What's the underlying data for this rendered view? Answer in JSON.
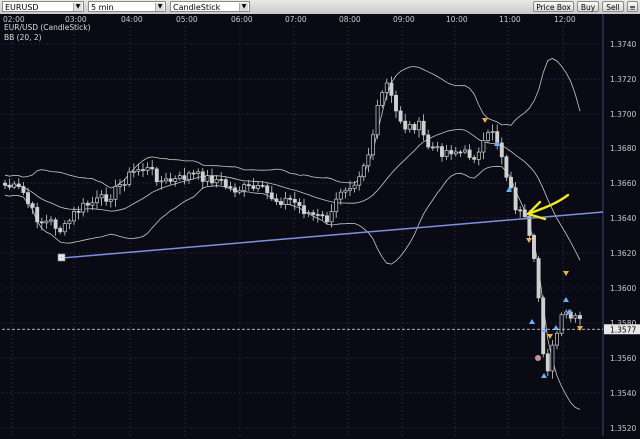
{
  "toolbar": {
    "symbol": "EURUSD",
    "timeframe": "5 min",
    "chart_type": "CandleStick",
    "price_box_label": "Price Box",
    "buy_label": "Buy",
    "sell_label": "Sell",
    "menu_label": "≡"
  },
  "chart": {
    "title": "EUR/USD (CandleStick)",
    "indicator": "BB (20, 2)",
    "time_labels": [
      "02:00",
      "03:00",
      "04:00",
      "05:00",
      "06:00",
      "07:00",
      "08:00",
      "09:00",
      "10:00",
      "11:00",
      "12:00"
    ],
    "price_labels": [
      "1.3740",
      "1.3720",
      "1.3700",
      "1.3680",
      "1.3660",
      "1.3640",
      "1.3620",
      "1.3600",
      "1.3580",
      "1.3560",
      "1.3540",
      "1.3520"
    ],
    "current_price": "1.3577",
    "trendline_marker": "·",
    "colors": {
      "background": "#0a0a14",
      "grid": "#1c2c4a",
      "candle": "#d0d0d0",
      "band": "#c8c8c8",
      "trendline": "#7f8fe0",
      "arrow": "#f0e820",
      "buy_marker": "#6ab0ff",
      "sell_marker": "#f0b040"
    }
  }
}
